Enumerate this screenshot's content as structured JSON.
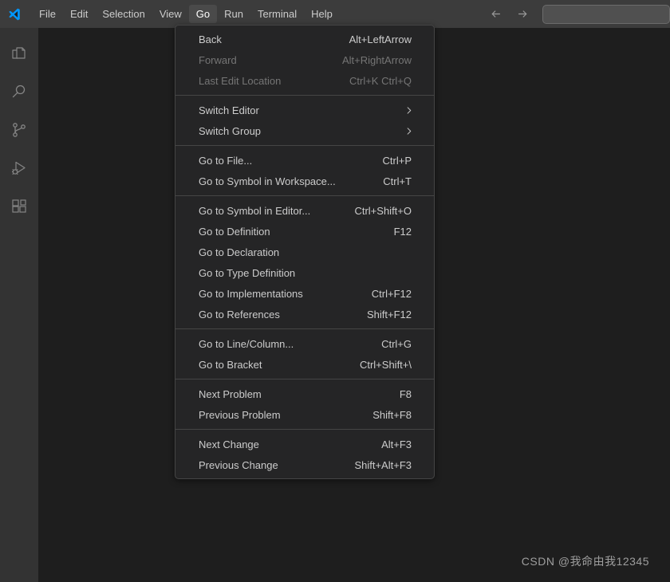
{
  "titlebar": {
    "logo_icon": "vscode-logo-icon",
    "menus": [
      {
        "label": "File",
        "active": false
      },
      {
        "label": "Edit",
        "active": false
      },
      {
        "label": "Selection",
        "active": false
      },
      {
        "label": "View",
        "active": false
      },
      {
        "label": "Go",
        "active": true
      },
      {
        "label": "Run",
        "active": false
      },
      {
        "label": "Terminal",
        "active": false
      },
      {
        "label": "Help",
        "active": false
      }
    ],
    "back_icon": "arrow-left-icon",
    "forward_icon": "arrow-right-icon",
    "command_box_value": "",
    "command_box_placeholder": ""
  },
  "activitybar": {
    "items": [
      {
        "icon": "explorer-files-icon",
        "label": "Explorer"
      },
      {
        "icon": "search-icon",
        "label": "Search"
      },
      {
        "icon": "source-control-branch-icon",
        "label": "Source Control"
      },
      {
        "icon": "run-and-debug-icon",
        "label": "Run and Debug"
      },
      {
        "icon": "extensions-blocks-icon",
        "label": "Extensions"
      }
    ]
  },
  "go_menu": {
    "groups": [
      {
        "items": [
          {
            "label": "Back",
            "key": "Alt+LeftArrow",
            "disabled": false,
            "submenu": false
          },
          {
            "label": "Forward",
            "key": "Alt+RightArrow",
            "disabled": true,
            "submenu": false
          },
          {
            "label": "Last Edit Location",
            "key": "Ctrl+K Ctrl+Q",
            "disabled": true,
            "submenu": false
          }
        ]
      },
      {
        "items": [
          {
            "label": "Switch Editor",
            "key": "",
            "disabled": false,
            "submenu": true
          },
          {
            "label": "Switch Group",
            "key": "",
            "disabled": false,
            "submenu": true
          }
        ]
      },
      {
        "items": [
          {
            "label": "Go to File...",
            "key": "Ctrl+P",
            "disabled": false,
            "submenu": false
          },
          {
            "label": "Go to Symbol in Workspace...",
            "key": "Ctrl+T",
            "disabled": false,
            "submenu": false
          }
        ]
      },
      {
        "items": [
          {
            "label": "Go to Symbol in Editor...",
            "key": "Ctrl+Shift+O",
            "disabled": false,
            "submenu": false
          },
          {
            "label": "Go to Definition",
            "key": "F12",
            "disabled": false,
            "submenu": false
          },
          {
            "label": "Go to Declaration",
            "key": "",
            "disabled": false,
            "submenu": false
          },
          {
            "label": "Go to Type Definition",
            "key": "",
            "disabled": false,
            "submenu": false
          },
          {
            "label": "Go to Implementations",
            "key": "Ctrl+F12",
            "disabled": false,
            "submenu": false
          },
          {
            "label": "Go to References",
            "key": "Shift+F12",
            "disabled": false,
            "submenu": false
          }
        ]
      },
      {
        "items": [
          {
            "label": "Go to Line/Column...",
            "key": "Ctrl+G",
            "disabled": false,
            "submenu": false
          },
          {
            "label": "Go to Bracket",
            "key": "Ctrl+Shift+\\",
            "disabled": false,
            "submenu": false
          }
        ]
      },
      {
        "items": [
          {
            "label": "Next Problem",
            "key": "F8",
            "disabled": false,
            "submenu": false
          },
          {
            "label": "Previous Problem",
            "key": "Shift+F8",
            "disabled": false,
            "submenu": false
          }
        ]
      },
      {
        "items": [
          {
            "label": "Next Change",
            "key": "Alt+F3",
            "disabled": false,
            "submenu": false
          },
          {
            "label": "Previous Change",
            "key": "Shift+Alt+F3",
            "disabled": false,
            "submenu": false
          }
        ]
      }
    ]
  },
  "editor": {
    "watermark": "CSDN @我命由我12345"
  },
  "colors": {
    "titlebar_bg": "#3c3c3c",
    "activitybar_bg": "#333333",
    "editor_bg": "#1e1e1e",
    "menu_bg": "#252526",
    "menu_border": "#454545",
    "text": "#cccccc",
    "text_disabled": "#757575",
    "accent": "#0098ff"
  }
}
